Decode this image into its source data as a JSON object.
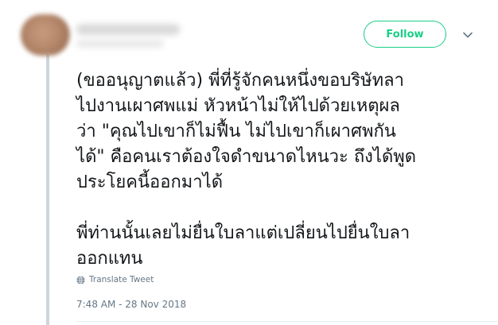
{
  "header": {
    "follow_label": "Follow"
  },
  "tweet": {
    "lines": [
      "(ขออนุญาตแล้ว) พี่ที่รู้จักคนหนึ่งขอบริษัทลา",
      "ไปงานเผาศพแม่ หัวหน้าไม่ให้ไปด้วยเหตุผล",
      "ว่า \"คุณไปเขาก็ไม่ฟื้น ไม่ไปเขาก็เผาศพกัน",
      "ได้\" คือคนเราต้องใจดำขนาดไหนวะ ถึงได้พูด",
      "ประโยคนี้ออกมาได้",
      "พี่ท่านนั้นเลยไม่ยื่นใบลาแต่เปลี่ยนไปยื่นใบลา",
      "ออกแทน"
    ],
    "translate_label": "Translate Tweet",
    "timestamp": "7:48 AM - 28 Nov 2018"
  },
  "colors": {
    "accent": "#19cf86",
    "muted_text": "#657786",
    "thread_line": "#ccd6dd"
  },
  "icons": {
    "caret": "chevron-down-icon",
    "translate": "globe-icon"
  }
}
